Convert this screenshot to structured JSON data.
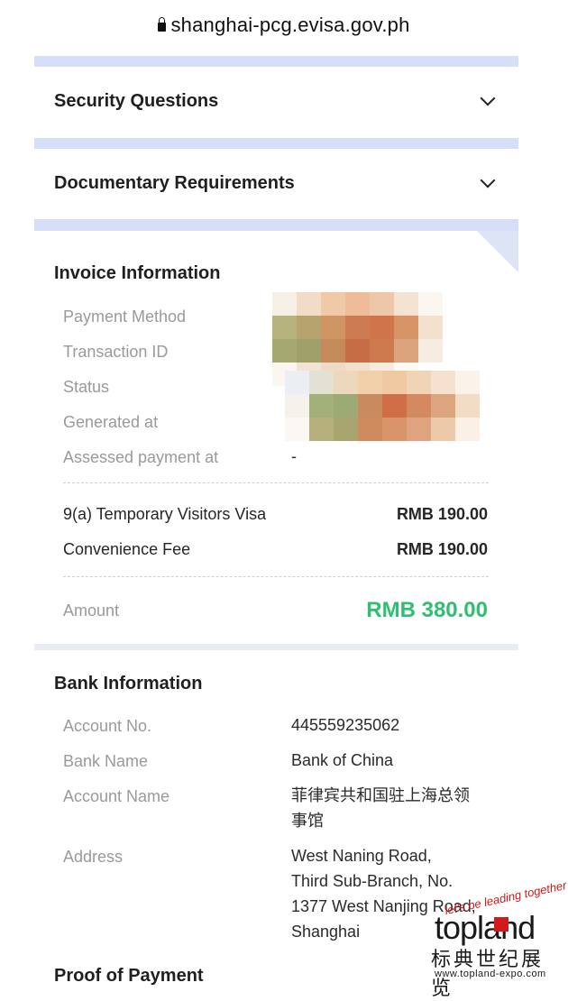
{
  "browser": {
    "url": "shanghai-pcg.evisa.gov.ph"
  },
  "accordions": [
    {
      "label": "Security Questions"
    },
    {
      "label": "Documentary Requirements"
    }
  ],
  "invoice": {
    "title": "Invoice Information",
    "fields": [
      {
        "label": "Payment Method",
        "value": ""
      },
      {
        "label": "Transaction ID",
        "value": ""
      },
      {
        "label": "Status",
        "value": ""
      },
      {
        "label": "Generated at",
        "value": ""
      },
      {
        "label": "Assessed payment at",
        "value": "-"
      }
    ],
    "items": [
      {
        "name": "9(a) Temporary Visitors Visa",
        "price": "RMB 190.00"
      },
      {
        "name": "Convenience Fee",
        "price": "RMB 190.00"
      }
    ],
    "amount_label": "Amount",
    "amount_value": "RMB 380.00"
  },
  "bank": {
    "title": "Bank Information",
    "fields": [
      {
        "label": "Account No.",
        "value": "445559235062"
      },
      {
        "label": "Bank Name",
        "value": "Bank of China"
      },
      {
        "label": "Account Name",
        "value_lines": [
          "菲律宾共和国驻上海总领",
          "事馆"
        ]
      },
      {
        "label": "Address",
        "value_lines": [
          "West Naning Road,",
          "Third Sub-Branch, No.",
          "1377 West Nanjing Road,",
          "Shanghai"
        ]
      }
    ]
  },
  "proof": {
    "title": "Proof of Payment"
  },
  "watermark": {
    "slogan": "let's be leading together",
    "brand": "topland",
    "chinese": "标典世纪展览",
    "url": "www.topland-expo.com"
  },
  "colors": {
    "accent_green": "#2fbf71",
    "band_blue": "#d6dff7"
  }
}
